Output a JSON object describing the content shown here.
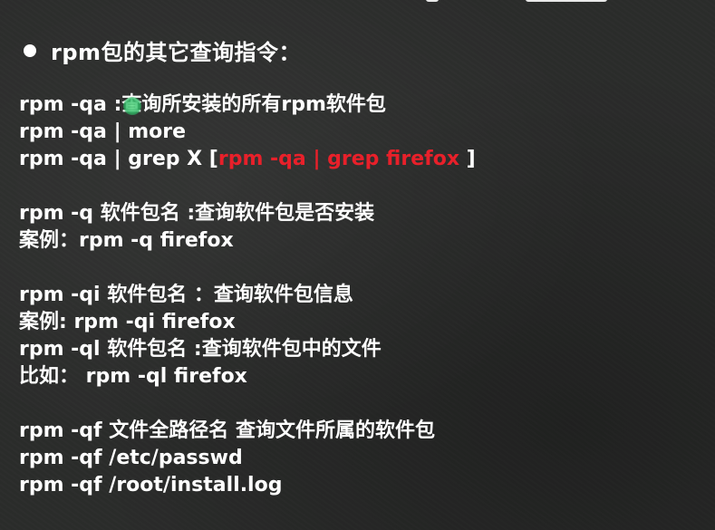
{
  "top_fragment": {
    "description_hidden": true
  },
  "heading": "rpm包的其它查询指令：",
  "lines": {
    "l1": "rpm -qa :查询所安装的所有rpm软件包",
    "l2": "rpm -qa | more",
    "l3_prefix": "rpm -qa | grep X [",
    "l3_red": "rpm -qa | grep firefox",
    "l3_suffix": " ]",
    "l4": "rpm -q 软件包名 :查询软件包是否安装",
    "l5": "案例：rpm -q firefox",
    "l6": "rpm -qi 软件包名 ：查询软件包信息",
    "l7": "案例: rpm -qi firefox",
    "l8": "rpm -ql 软件包名 :查询软件包中的文件",
    "l9": "比如： rpm -ql firefox",
    "l10": "rpm -qf 文件全路径名 查询文件所属的软件包",
    "l11": "rpm -qf /etc/passwd",
    "l12": "rpm -qf /root/install.log"
  },
  "colors": {
    "background": "#2b2c2b",
    "text": "#ffffff",
    "highlight": "#e8202a",
    "cursor": "#2fb865"
  }
}
